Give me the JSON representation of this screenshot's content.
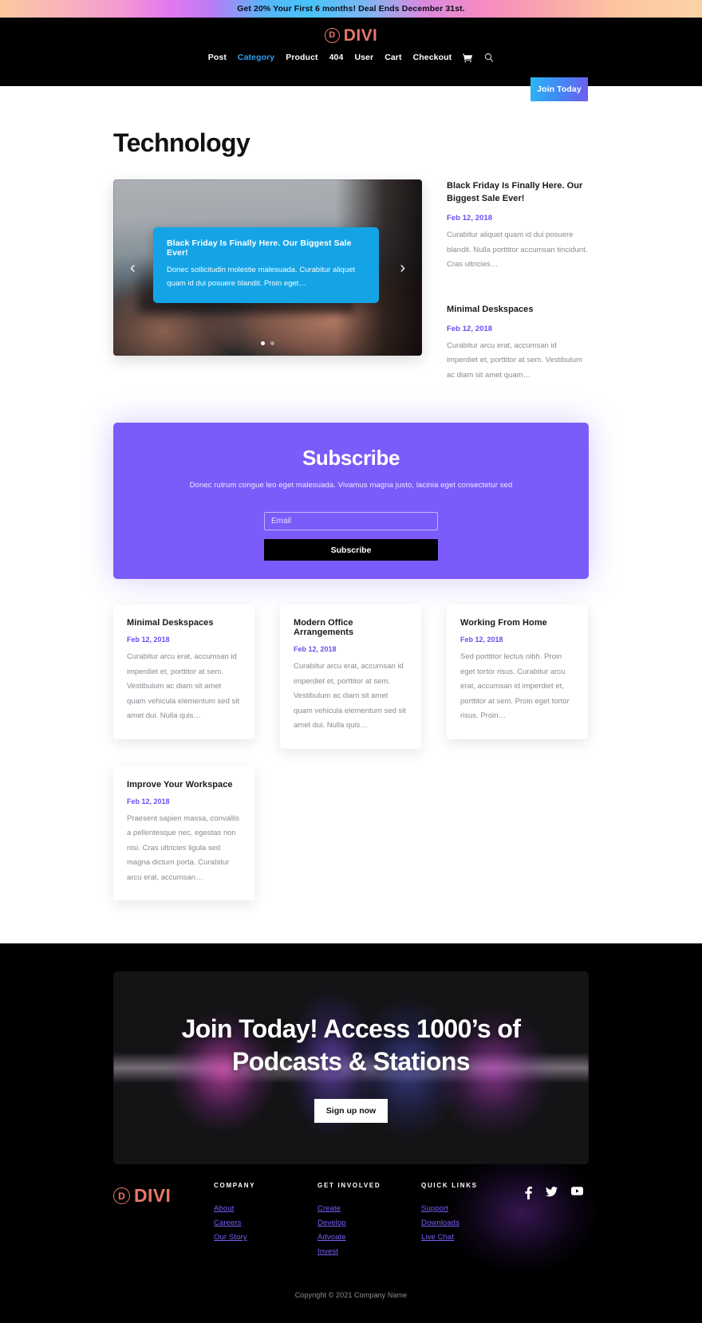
{
  "announcement": {
    "text": "Get 20% Your First 6 months! Deal Ends December 31st."
  },
  "header": {
    "logo_letter": "D",
    "logo_word": "DIVI",
    "nav": [
      {
        "label": "Post",
        "active": false
      },
      {
        "label": "Category",
        "active": true
      },
      {
        "label": "Product",
        "active": false
      },
      {
        "label": "404",
        "active": false
      },
      {
        "label": "User",
        "active": false
      },
      {
        "label": "Cart",
        "active": false
      },
      {
        "label": "Checkout",
        "active": false
      }
    ],
    "cart_icon": "cart-icon",
    "search_icon": "search-icon",
    "join_button": "Join Today"
  },
  "main": {
    "page_title": "Technology",
    "slider": {
      "caption_title": "Black Friday Is Finally Here. Our Biggest Sale Ever!",
      "caption_text": "Donec sollicitudin molestie malesuada. Curabitur aliquet quam id dui posuere blandit. Proin eget…",
      "prev_arrow": "‹",
      "next_arrow": "›",
      "dots": 2,
      "active_dot": 0
    },
    "side_posts": [
      {
        "title": "Black Friday Is Finally Here. Our Biggest Sale Ever!",
        "date": "Feb 12, 2018",
        "excerpt": "Curabitur aliquet quam id dui posuere blandit. Nulla porttitor accumsan tincidunt. Cras ultricies…"
      },
      {
        "title": "Minimal Deskspaces",
        "date": "Feb 12, 2018",
        "excerpt": "Curabitur arcu erat, accumsan id imperdiet et, porttitor at sem. Vestibulum ac diam sit amet quam…"
      }
    ],
    "subscribe": {
      "title": "Subscribe",
      "description": "Donec rutrum congue leo eget malesuada. Vivamus magna justo, lacinia eget consectetur sed",
      "email_placeholder": "Email",
      "email_value": "",
      "button": "Subscribe"
    },
    "cards": [
      {
        "title": "Minimal Deskspaces",
        "date": "Feb 12, 2018",
        "excerpt": "Curabitur arcu erat, accumsan id imperdiet et, porttitor at sem. Vestibulum ac diam sit amet quam vehicula elementum sed sit amet dui. Nulla quis…"
      },
      {
        "title": "Modern Office Arrangements",
        "date": "Feb 12, 2018",
        "excerpt": "Curabitur arcu erat, accumsan id imperdiet et, porttitor at sem. Vestibulum ac diam sit amet quam vehicula elementum sed sit amet dui. Nulla quis…"
      },
      {
        "title": "Working From Home",
        "date": "Feb 12, 2018",
        "excerpt": "Sed porttitor lectus nibh. Proin eget tortor risus. Curabitur arcu erat, accumsan id imperdiet et, porttitor at sem. Proin eget tortor risus. Proin…"
      },
      {
        "title": "Improve Your Workspace",
        "date": "Feb 12, 2018",
        "excerpt": "Praesent sapien massa, convallis a pellentesque nec, egestas non nisi. Cras ultricies ligula sed magna dictum porta. Curabitur arcu erat, accumsan…"
      }
    ]
  },
  "cta": {
    "line1": "Join Today! Access 1000’s of",
    "line2": "Podcasts & Stations",
    "button": "Sign up now"
  },
  "footer": {
    "logo_letter": "D",
    "logo_word": "DIVI",
    "columns": [
      {
        "heading": "Company",
        "links": [
          "About",
          "Careers",
          "Our Story"
        ]
      },
      {
        "heading": "Get Involved",
        "links": [
          "Create",
          "Develop",
          "Advoate",
          "Invest"
        ]
      },
      {
        "heading": "Quick Links",
        "links": [
          "Support",
          "Downloads",
          "Live Chat"
        ]
      }
    ],
    "social": [
      "facebook-icon",
      "twitter-icon",
      "youtube-icon"
    ],
    "copyright": "Copyright © 2021 Company Name"
  },
  "colors": {
    "brand_coral": "#e8776a",
    "accent_purple": "#7b5cfa",
    "accent_blue": "#14a4e6",
    "nav_active": "#2f9ff0"
  }
}
